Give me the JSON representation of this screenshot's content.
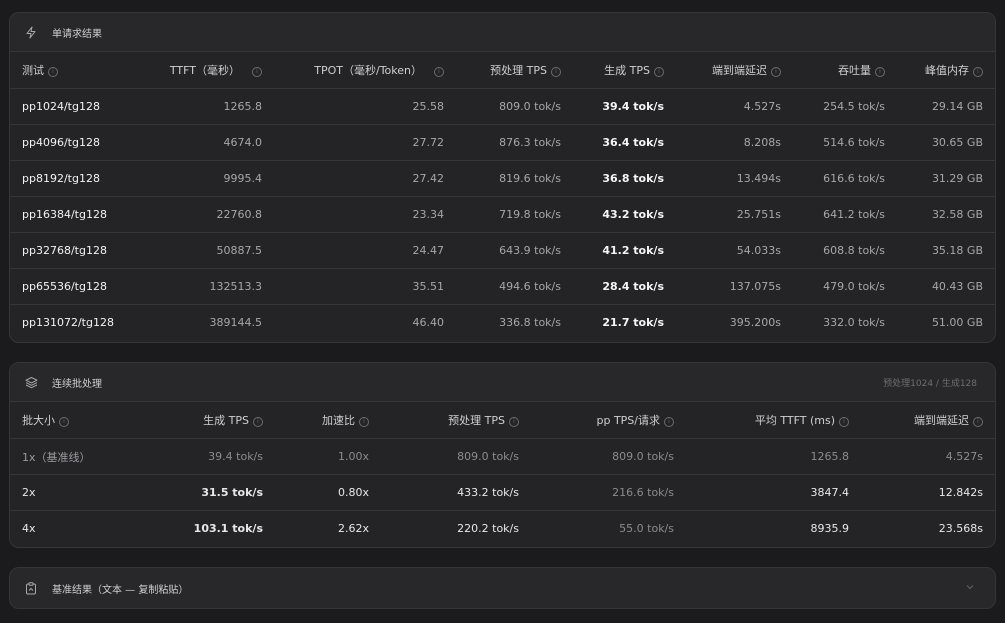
{
  "single": {
    "title": "单请求结果",
    "columns": [
      "测试",
      "TTFT（毫秒）",
      "TPOT（毫秒/Token）",
      "预处理 TPS",
      "生成 TPS",
      "端到端延迟",
      "吞吐量",
      "峰值内存"
    ],
    "rows": [
      [
        "pp1024/tg128",
        "1265.8",
        "25.58",
        "809.0 tok/s",
        "39.4 tok/s",
        "4.527s",
        "254.5 tok/s",
        "29.14 GB"
      ],
      [
        "pp4096/tg128",
        "4674.0",
        "27.72",
        "876.3 tok/s",
        "36.4 tok/s",
        "8.208s",
        "514.6 tok/s",
        "30.65 GB"
      ],
      [
        "pp8192/tg128",
        "9995.4",
        "27.42",
        "819.6 tok/s",
        "36.8 tok/s",
        "13.494s",
        "616.6 tok/s",
        "31.29 GB"
      ],
      [
        "pp16384/tg128",
        "22760.8",
        "23.34",
        "719.8 tok/s",
        "43.2 tok/s",
        "25.751s",
        "641.2 tok/s",
        "32.58 GB"
      ],
      [
        "pp32768/tg128",
        "50887.5",
        "24.47",
        "643.9 tok/s",
        "41.2 tok/s",
        "54.033s",
        "608.8 tok/s",
        "35.18 GB"
      ],
      [
        "pp65536/tg128",
        "132513.3",
        "35.51",
        "494.6 tok/s",
        "28.4 tok/s",
        "137.075s",
        "479.0 tok/s",
        "40.43 GB"
      ],
      [
        "pp131072/tg128",
        "389144.5",
        "46.40",
        "336.8 tok/s",
        "21.7 tok/s",
        "395.200s",
        "332.0 tok/s",
        "51.00 GB"
      ]
    ]
  },
  "batch": {
    "title": "连续批处理",
    "note": "预处理1024 / 生成128",
    "columns": [
      "批大小",
      "生成 TPS",
      "加速比",
      "预处理 TPS",
      "pp TPS/请求",
      "平均 TTFT (ms)",
      "端到端延迟"
    ],
    "rows": [
      [
        "1x（基准线）",
        "39.4 tok/s",
        "1.00x",
        "809.0 tok/s",
        "809.0 tok/s",
        "1265.8",
        "4.527s"
      ],
      [
        "2x",
        "31.5 tok/s",
        "0.80x",
        "433.2 tok/s",
        "216.6 tok/s",
        "3847.4",
        "12.842s"
      ],
      [
        "4x",
        "103.1 tok/s",
        "2.62x",
        "220.2 tok/s",
        "55.0 tok/s",
        "8935.9",
        "23.568s"
      ]
    ]
  },
  "baseline": {
    "title": "基准结果（文本 — 复制粘贴）"
  },
  "icons": {
    "single": "lightning-icon",
    "batch": "layers-icon",
    "baseline": "clipboard-icon",
    "info": "info-icon",
    "expand": "chevron-down-icon"
  },
  "colors": {
    "background": "#1b1b1d",
    "card": "#242427",
    "border": "#36363a",
    "highlight": "#3ad36b"
  }
}
